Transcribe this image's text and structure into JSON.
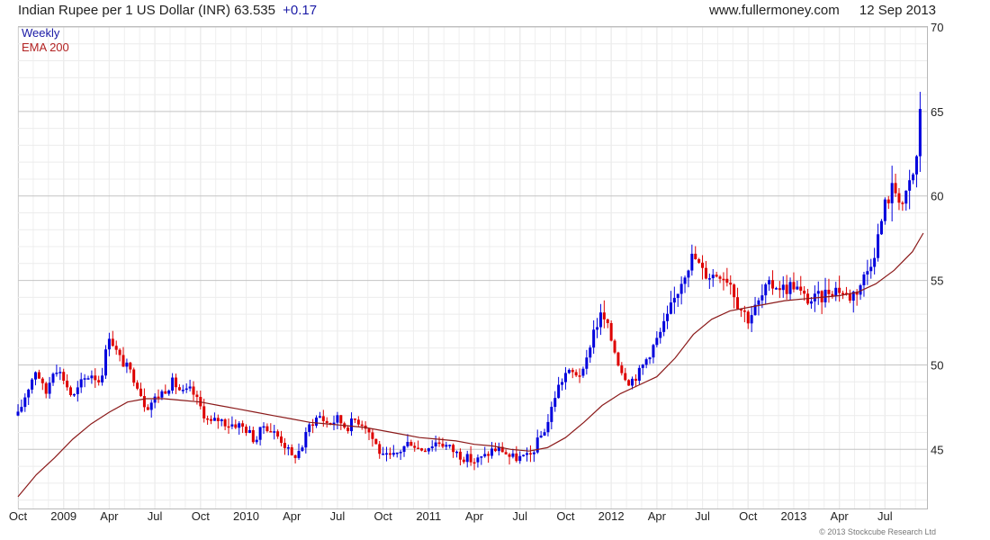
{
  "header": {
    "title": "Indian Rupee per 1 US Dollar (INR) 63.535",
    "change": "+0.17",
    "website": "www.fullermoney.com",
    "date": "12 Sep 2013"
  },
  "legend": {
    "series1": "Weekly",
    "series2": "EMA 200"
  },
  "copyright": "© 2013 Stockcube Research Ltd",
  "colors": {
    "up": "#0000dd",
    "down": "#dd0000",
    "ema": "#8b1a1a",
    "grid": "#d9d9d9"
  },
  "chart_data": {
    "type": "candlestick",
    "title": "Indian Rupee per 1 US Dollar (INR) 63.535 +0.17",
    "ylim": [
      41.5,
      70
    ],
    "y_ticks": [
      45,
      50,
      55,
      60,
      65,
      70
    ],
    "x_tick_labels": [
      "Oct",
      "2009",
      "Apr",
      "Jul",
      "Oct",
      "2010",
      "Apr",
      "Jul",
      "Oct",
      "2011",
      "Apr",
      "Jul",
      "Oct",
      "2012",
      "Apr",
      "Jul",
      "Oct",
      "2013",
      "Apr",
      "Jul"
    ],
    "grid": true,
    "legend_position": "top-left",
    "price_path": [
      [
        2008.75,
        47.0
      ],
      [
        2008.8,
        48.5
      ],
      [
        2008.85,
        49.8
      ],
      [
        2008.9,
        48.2
      ],
      [
        2008.95,
        50.0
      ],
      [
        2009.0,
        49.2
      ],
      [
        2009.05,
        48.0
      ],
      [
        2009.1,
        49.0
      ],
      [
        2009.15,
        49.5
      ],
      [
        2009.2,
        49.0
      ],
      [
        2009.25,
        51.8
      ],
      [
        2009.3,
        50.5
      ],
      [
        2009.35,
        49.8
      ],
      [
        2009.4,
        49.0
      ],
      [
        2009.45,
        47.5
      ],
      [
        2009.5,
        48.0
      ],
      [
        2009.55,
        48.5
      ],
      [
        2009.6,
        49.0
      ],
      [
        2009.65,
        48.3
      ],
      [
        2009.7,
        48.5
      ],
      [
        2009.75,
        47.5
      ],
      [
        2009.8,
        46.5
      ],
      [
        2009.85,
        46.8
      ],
      [
        2009.9,
        46.5
      ],
      [
        2009.95,
        46.5
      ],
      [
        2010.0,
        46.2
      ],
      [
        2010.05,
        45.5
      ],
      [
        2010.1,
        46.5
      ],
      [
        2010.15,
        46.0
      ],
      [
        2010.2,
        45.5
      ],
      [
        2010.25,
        44.5
      ],
      [
        2010.3,
        45.0
      ],
      [
        2010.35,
        46.5
      ],
      [
        2010.4,
        47.0
      ],
      [
        2010.45,
        46.5
      ],
      [
        2010.5,
        46.8
      ],
      [
        2010.55,
        46.3
      ],
      [
        2010.6,
        46.8
      ],
      [
        2010.65,
        46.5
      ],
      [
        2010.7,
        45.5
      ],
      [
        2010.75,
        44.5
      ],
      [
        2010.8,
        44.5
      ],
      [
        2010.85,
        45.0
      ],
      [
        2010.9,
        45.5
      ],
      [
        2010.95,
        45.0
      ],
      [
        2011.0,
        45.2
      ],
      [
        2011.05,
        45.5
      ],
      [
        2011.1,
        45.2
      ],
      [
        2011.15,
        44.8
      ],
      [
        2011.2,
        44.5
      ],
      [
        2011.25,
        44.3
      ],
      [
        2011.3,
        44.5
      ],
      [
        2011.35,
        45.0
      ],
      [
        2011.4,
        45.0
      ],
      [
        2011.45,
        44.5
      ],
      [
        2011.5,
        44.5
      ],
      [
        2011.55,
        44.5
      ],
      [
        2011.6,
        45.5
      ],
      [
        2011.65,
        46.5
      ],
      [
        2011.7,
        48.5
      ],
      [
        2011.75,
        49.5
      ],
      [
        2011.8,
        49.5
      ],
      [
        2011.85,
        49.5
      ],
      [
        2011.9,
        52.0
      ],
      [
        2011.95,
        53.0
      ],
      [
        2012.0,
        51.5
      ],
      [
        2012.05,
        49.8
      ],
      [
        2012.1,
        49.0
      ],
      [
        2012.15,
        49.5
      ],
      [
        2012.2,
        50.5
      ],
      [
        2012.25,
        51.5
      ],
      [
        2012.3,
        52.5
      ],
      [
        2012.35,
        54.0
      ],
      [
        2012.4,
        55.5
      ],
      [
        2012.45,
        56.5
      ],
      [
        2012.5,
        55.5
      ],
      [
        2012.55,
        55.3
      ],
      [
        2012.6,
        55.5
      ],
      [
        2012.65,
        55.0
      ],
      [
        2012.7,
        53.5
      ],
      [
        2012.75,
        52.8
      ],
      [
        2012.8,
        53.5
      ],
      [
        2012.85,
        54.5
      ],
      [
        2012.9,
        54.8
      ],
      [
        2012.95,
        54.5
      ],
      [
        2013.0,
        54.8
      ],
      [
        2013.05,
        54.0
      ],
      [
        2013.1,
        53.8
      ],
      [
        2013.15,
        54.0
      ],
      [
        2013.2,
        54.5
      ],
      [
        2013.25,
        54.5
      ],
      [
        2013.3,
        54.0
      ],
      [
        2013.35,
        54.5
      ],
      [
        2013.4,
        55.5
      ],
      [
        2013.45,
        57.0
      ],
      [
        2013.5,
        59.5
      ],
      [
        2013.55,
        60.5
      ],
      [
        2013.6,
        59.5
      ],
      [
        2013.65,
        61.0
      ],
      [
        2013.68,
        62.5
      ],
      [
        2013.69,
        65.0
      ],
      [
        2013.7,
        66.0
      ],
      [
        2013.71,
        63.5
      ]
    ],
    "ema_path": [
      [
        2008.75,
        42.2
      ],
      [
        2008.85,
        43.5
      ],
      [
        2008.95,
        44.5
      ],
      [
        2009.05,
        45.6
      ],
      [
        2009.15,
        46.5
      ],
      [
        2009.25,
        47.2
      ],
      [
        2009.35,
        47.8
      ],
      [
        2009.45,
        48.0
      ],
      [
        2009.55,
        48.0
      ],
      [
        2009.65,
        47.9
      ],
      [
        2009.75,
        47.8
      ],
      [
        2009.85,
        47.6
      ],
      [
        2009.95,
        47.4
      ],
      [
        2010.05,
        47.2
      ],
      [
        2010.15,
        47.0
      ],
      [
        2010.25,
        46.8
      ],
      [
        2010.35,
        46.6
      ],
      [
        2010.45,
        46.5
      ],
      [
        2010.55,
        46.4
      ],
      [
        2010.65,
        46.3
      ],
      [
        2010.75,
        46.1
      ],
      [
        2010.85,
        45.9
      ],
      [
        2010.95,
        45.7
      ],
      [
        2011.05,
        45.6
      ],
      [
        2011.15,
        45.5
      ],
      [
        2011.25,
        45.3
      ],
      [
        2011.35,
        45.2
      ],
      [
        2011.45,
        45.0
      ],
      [
        2011.55,
        44.9
      ],
      [
        2011.65,
        45.1
      ],
      [
        2011.75,
        45.7
      ],
      [
        2011.85,
        46.6
      ],
      [
        2011.95,
        47.6
      ],
      [
        2012.05,
        48.3
      ],
      [
        2012.15,
        48.8
      ],
      [
        2012.25,
        49.3
      ],
      [
        2012.35,
        50.4
      ],
      [
        2012.45,
        51.8
      ],
      [
        2012.55,
        52.7
      ],
      [
        2012.65,
        53.2
      ],
      [
        2012.75,
        53.4
      ],
      [
        2012.85,
        53.6
      ],
      [
        2012.95,
        53.8
      ],
      [
        2013.05,
        53.9
      ],
      [
        2013.15,
        54.0
      ],
      [
        2013.25,
        54.1
      ],
      [
        2013.35,
        54.3
      ],
      [
        2013.45,
        54.8
      ],
      [
        2013.55,
        55.6
      ],
      [
        2013.65,
        56.7
      ],
      [
        2013.71,
        57.8
      ]
    ]
  }
}
